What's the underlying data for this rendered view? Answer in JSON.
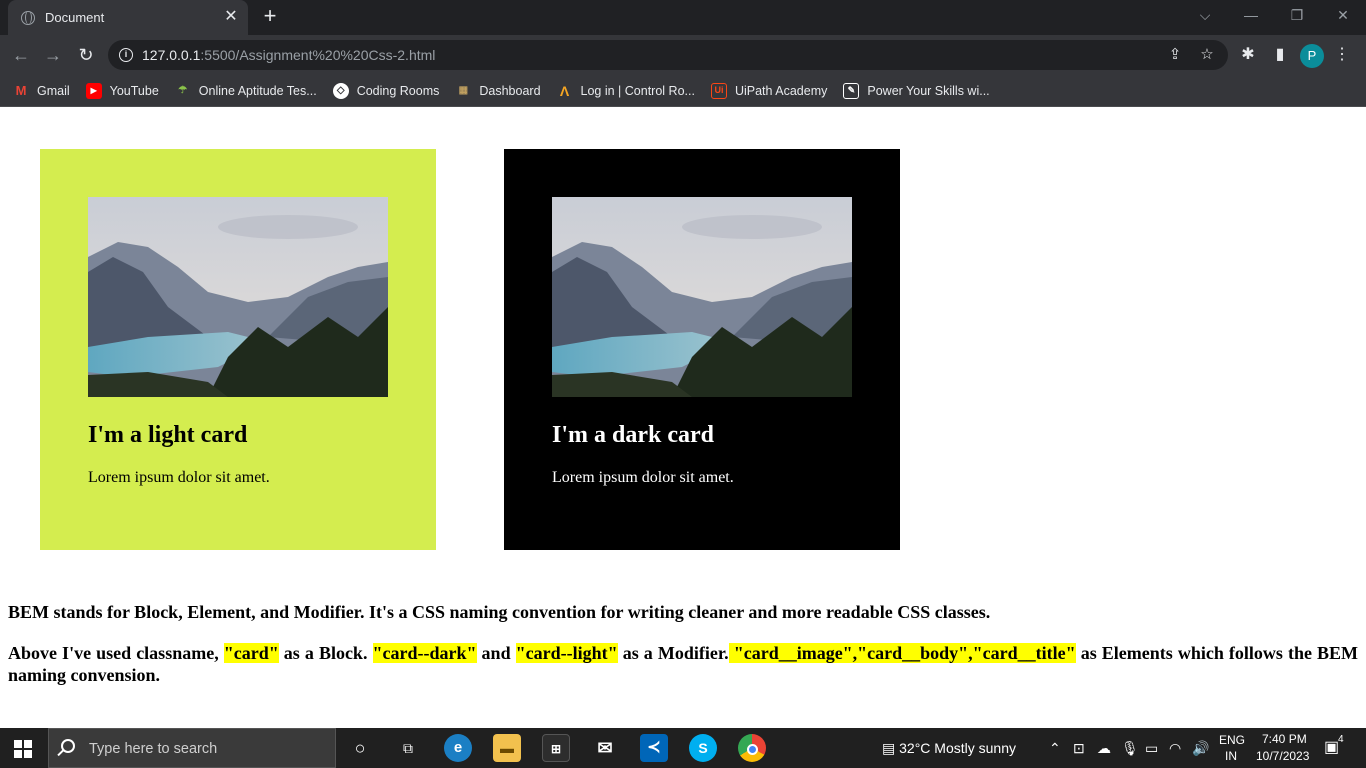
{
  "browser": {
    "tab_title": "Document",
    "url_host": "127.0.0.1",
    "url_rest": ":5500/Assignment%20%20Css-2.html",
    "profile_initial": "P"
  },
  "bookmarks": [
    {
      "label": "Gmail",
      "icon": "gmail-icon",
      "color": "#ea4335"
    },
    {
      "label": "YouTube",
      "icon": "youtube-icon",
      "color": "#ff0000"
    },
    {
      "label": "Online Aptitude Tes...",
      "icon": "aptitude-icon",
      "color": "#8bc34a"
    },
    {
      "label": "Coding Rooms",
      "icon": "coding-rooms-icon",
      "color": "#ffffff"
    },
    {
      "label": "Dashboard",
      "icon": "dashboard-icon",
      "color": "#c0a060"
    },
    {
      "label": "Log in | Control Ro...",
      "icon": "control-room-icon",
      "color": "#f5a623"
    },
    {
      "label": "UiPath Academy",
      "icon": "uipath-icon",
      "color": "#fa4616"
    },
    {
      "label": "Power Your Skills wi...",
      "icon": "power-skills-icon",
      "color": "#ffffff"
    }
  ],
  "cards": {
    "light": {
      "title": "I'm a light card",
      "body": "Lorem ipsum dolor sit amet."
    },
    "dark": {
      "title": "I'm a dark card",
      "body": "Lorem ipsum dolor sit amet."
    }
  },
  "bem": {
    "line1": "BEM stands for Block, Element, and Modifier. It's a CSS naming convention for writing cleaner and more readable CSS classes.",
    "p2_a": "Above I've used classname, ",
    "p2_hl1": "\"card\"",
    "p2_b": " as a Block. ",
    "p2_hl2": "\"card--dark\"",
    "p2_c": " and ",
    "p2_hl3": "\"card--light\"",
    "p2_d": " as a Modifier.",
    "p2_hl4": " \"card__image\",\"card__body\",\"card__title\"",
    "p2_e": " as Elements which follows the BEM naming convension."
  },
  "taskbar": {
    "search_placeholder": "Type here to search",
    "weather": "32°C  Mostly sunny",
    "lang_top": "ENG",
    "lang_bottom": "IN",
    "time": "7:40 PM",
    "date": "10/7/2023",
    "notification_count": "4"
  },
  "colors": {
    "light_card": "#d4ed4f",
    "dark_card": "#000000",
    "highlight": "#ffff00"
  }
}
